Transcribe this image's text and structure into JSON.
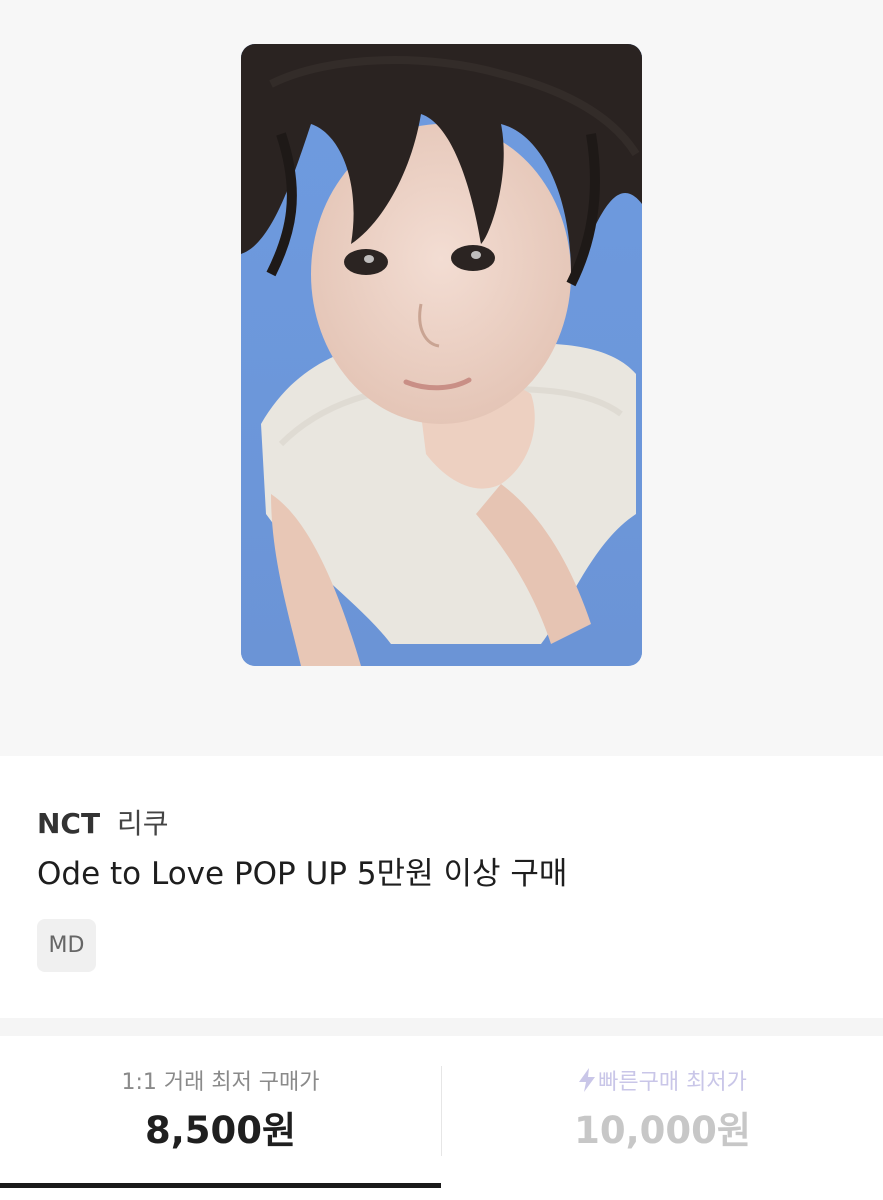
{
  "product": {
    "group": "NCT",
    "member": "리쿠",
    "title": "Ode to Love POP UP 5만원 이상 구매",
    "tag": "MD",
    "image_icon": "photocard-image"
  },
  "prices": {
    "one_to_one": {
      "label": "1:1 거래 최저 구매가",
      "value": "8,500원",
      "selected": true
    },
    "quick_buy": {
      "icon": "lightning-bolt-icon",
      "label": "빠른구매 최저가",
      "value": "10,000원",
      "selected": false
    }
  },
  "colors": {
    "photo_background": "#6f9ddf",
    "quick_buy_accent": "#c9c6e8",
    "active_underline": "#1a1a1a"
  }
}
